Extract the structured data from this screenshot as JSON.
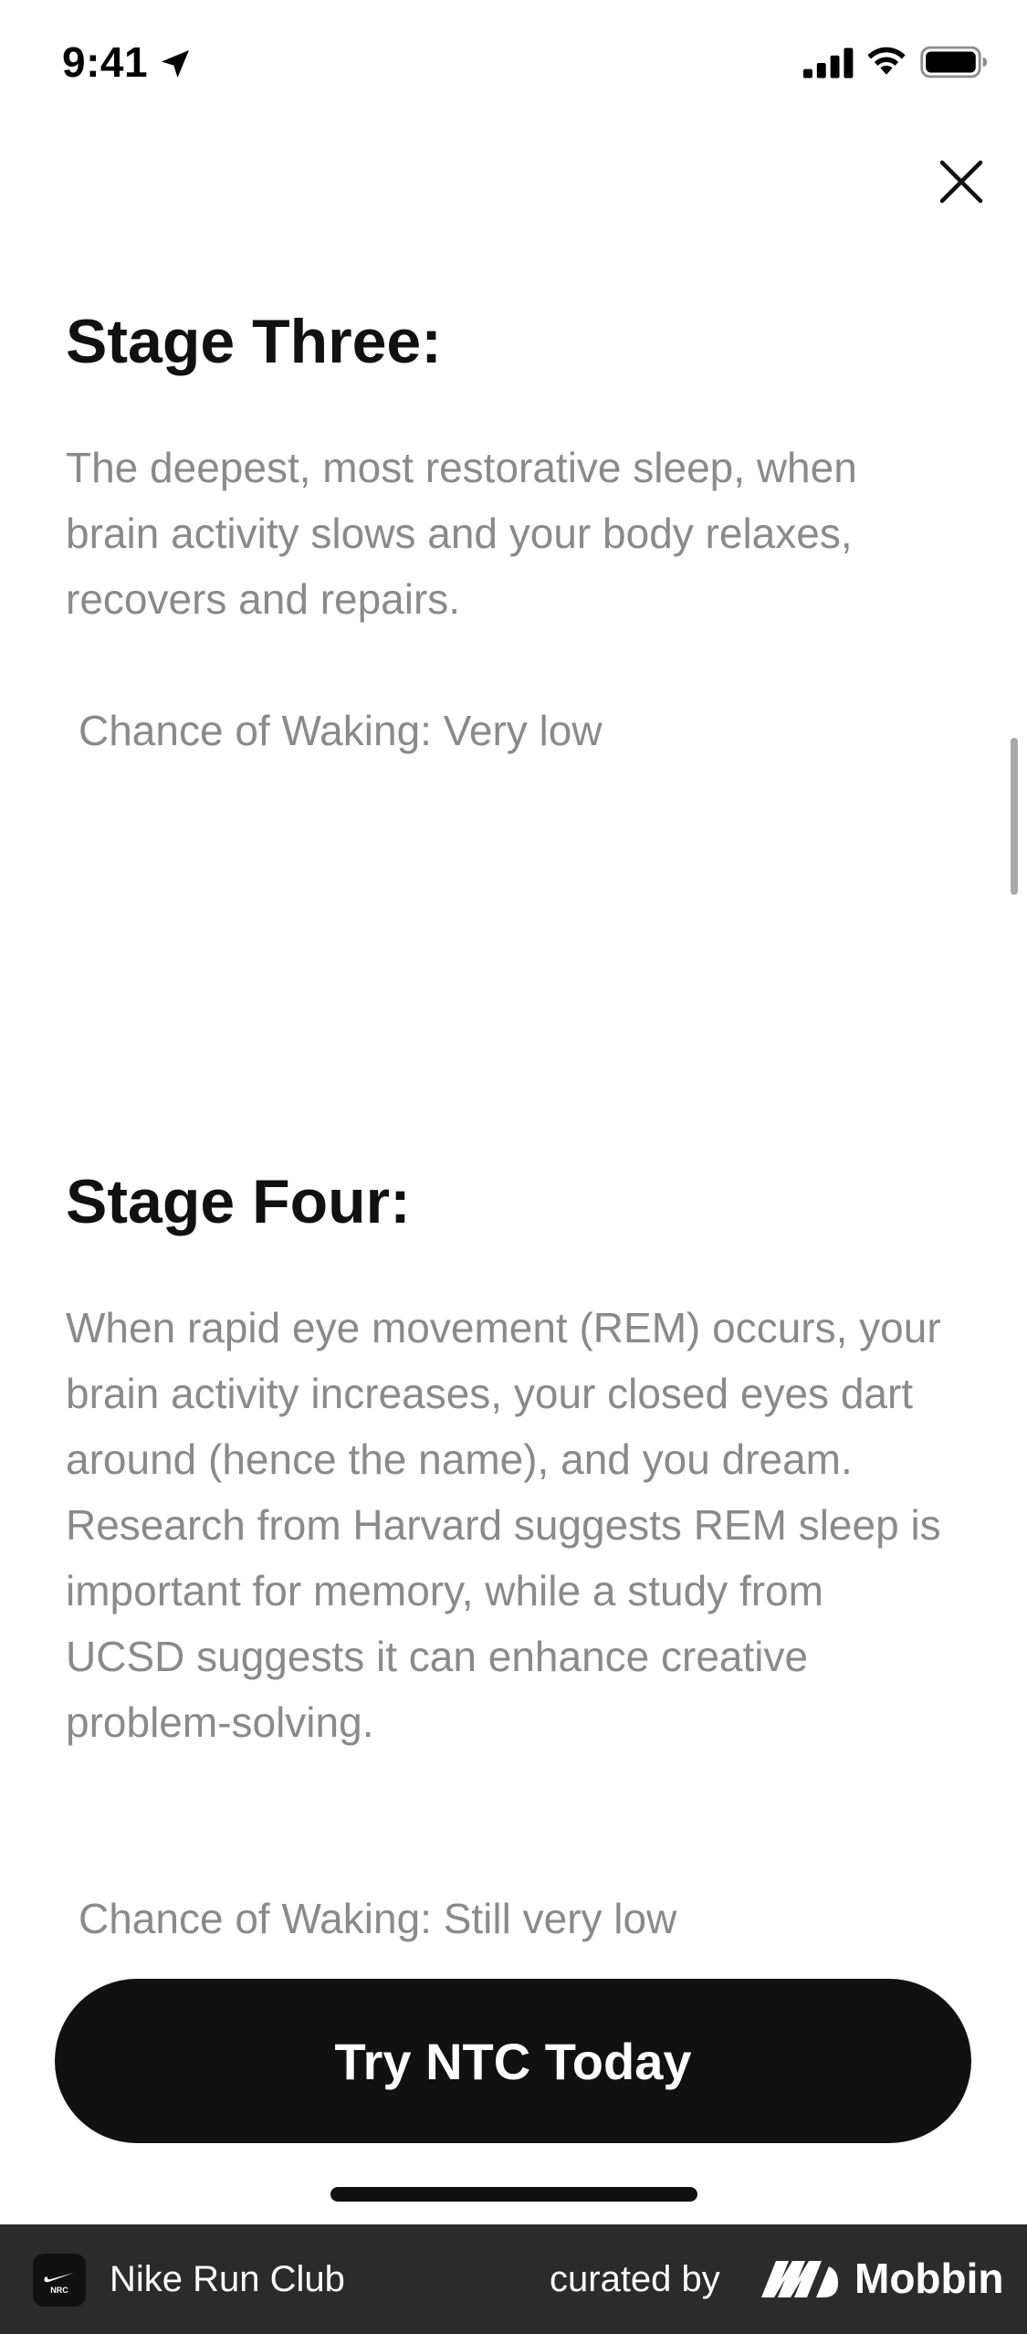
{
  "status_bar": {
    "time": "9:41",
    "icons": [
      "location-arrow-icon",
      "signal-icon",
      "wifi-icon",
      "battery-icon"
    ]
  },
  "close_icon": "close-icon",
  "stages": [
    {
      "title": "Stage Three:",
      "body": "The deepest, most restorative sleep, when brain activity slows and your body relaxes, recovers and repairs.",
      "waking": "Chance of Waking: Very low"
    },
    {
      "title": "Stage Four:",
      "body": "When rapid eye movement (REM) occurs, your brain activity increases, your closed eyes dart around (hence the name), and you dream. Research from Harvard suggests REM sleep is important for memory, while a study from UCSD suggests it can enhance creative problem-solving.",
      "waking": "Chance of Waking: Still very low"
    }
  ],
  "cta": {
    "label": "Try NTC Today"
  },
  "footer": {
    "app_name": "Nike Run Club",
    "app_logo_text": "NRC",
    "curated_by": "curated by",
    "brand": "Mobbin"
  },
  "colors": {
    "title": "#111111",
    "body_text": "#8a8a8a",
    "cta_bg": "#111111",
    "cta_text": "#ffffff",
    "footer_bg": "#2b2b2b"
  }
}
